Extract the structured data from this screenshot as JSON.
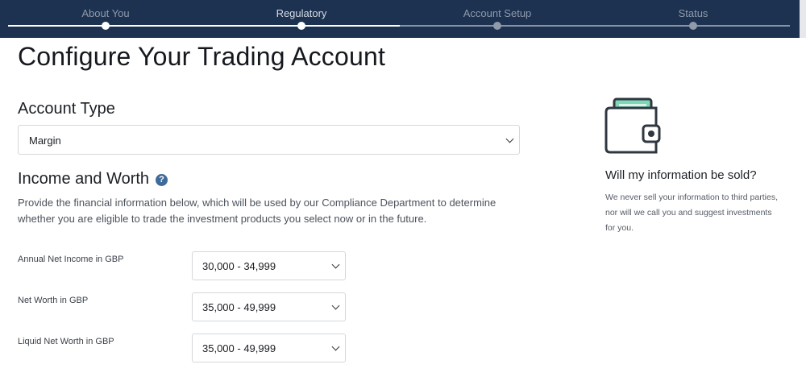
{
  "progress": {
    "steps": [
      {
        "label": "About You",
        "state": "done"
      },
      {
        "label": "Regulatory",
        "state": "current"
      },
      {
        "label": "Account Setup",
        "state": "upcoming"
      },
      {
        "label": "Status",
        "state": "upcoming"
      }
    ]
  },
  "page": {
    "title": "Configure Your Trading Account"
  },
  "account_type": {
    "heading": "Account Type",
    "selected": "Margin"
  },
  "income_worth": {
    "heading": "Income and Worth",
    "help_glyph": "?",
    "description": "Provide the financial information below, which will be used by our Compliance Department to determine whether you are eligible to trade the investment products you select now or in the future.",
    "fields": [
      {
        "label": "Annual Net Income in GBP",
        "selected": "30,000 - 34,999"
      },
      {
        "label": "Net Worth in GBP",
        "selected": "35,000 - 49,999"
      },
      {
        "label": "Liquid Net Worth in GBP",
        "selected": "35,000 - 49,999"
      }
    ]
  },
  "sidebar": {
    "icon": "wallet-icon",
    "title": "Will my information be sold?",
    "text": "We never sell your information to third parties, nor will we call you and suggest investments for you."
  },
  "colors": {
    "header_bg": "#1d3250",
    "accent_help": "#3f6a9c",
    "wallet_card": "#7fd6b8"
  }
}
